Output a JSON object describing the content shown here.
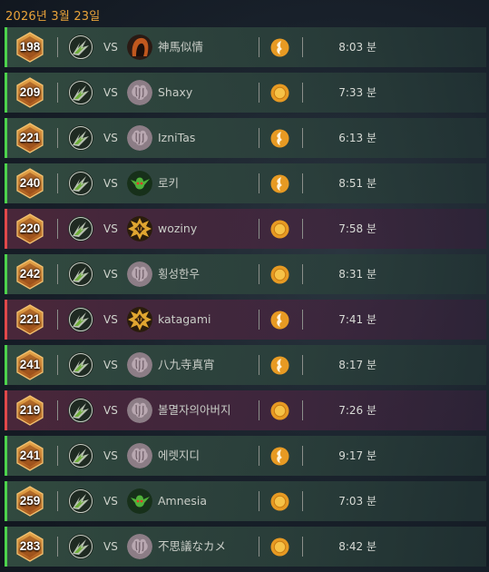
{
  "date_label": "2026년 3월 23일",
  "vs_label": "VS",
  "colors": {
    "win": "#4cd24c",
    "loss": "#e0484a",
    "accent": "#e9a33a"
  },
  "matches": [
    {
      "result": "win",
      "rating": "198",
      "opponent_icon": "hooded-icon",
      "opponent": "神馬似情",
      "medal": "swirl-medal-icon",
      "duration": "8:03 분"
    },
    {
      "result": "win",
      "rating": "209",
      "opponent_icon": "brain-icon",
      "opponent": "Shaxy",
      "medal": "coin-medal-icon",
      "duration": "7:33 분"
    },
    {
      "result": "win",
      "rating": "221",
      "opponent_icon": "brain-icon",
      "opponent": "IzniTas",
      "medal": "swirl-medal-icon",
      "duration": "6:13 분"
    },
    {
      "result": "win",
      "rating": "240",
      "opponent_icon": "goblin-icon",
      "opponent": "로키",
      "medal": "swirl-medal-icon",
      "duration": "8:51 분"
    },
    {
      "result": "loss",
      "rating": "220",
      "opponent_icon": "spiky-icon",
      "opponent": "woziny",
      "medal": "coin-medal-icon",
      "duration": "7:58 분"
    },
    {
      "result": "win",
      "rating": "242",
      "opponent_icon": "brain-icon",
      "opponent": "횡성한우",
      "medal": "coin-medal-icon",
      "duration": "8:31 분"
    },
    {
      "result": "loss",
      "rating": "221",
      "opponent_icon": "spiky-icon",
      "opponent": "katagami",
      "medal": "swirl-medal-icon",
      "duration": "7:41 분"
    },
    {
      "result": "win",
      "rating": "241",
      "opponent_icon": "brain-icon",
      "opponent": "八九寺真宵",
      "medal": "swirl-medal-icon",
      "duration": "8:17 분"
    },
    {
      "result": "loss",
      "rating": "219",
      "opponent_icon": "brain-icon",
      "opponent": "볼멸자의아버지",
      "medal": "coin-medal-icon",
      "duration": "7:26 분"
    },
    {
      "result": "win",
      "rating": "241",
      "opponent_icon": "brain-icon",
      "opponent": "에렛지디",
      "medal": "swirl-medal-icon",
      "duration": "9:17 분"
    },
    {
      "result": "win",
      "rating": "259",
      "opponent_icon": "goblin-icon",
      "opponent": "Amnesia",
      "medal": "coin-medal-icon",
      "duration": "7:03 분"
    },
    {
      "result": "win",
      "rating": "283",
      "opponent_icon": "brain-icon",
      "opponent": "不思議なカメ",
      "medal": "coin-medal-icon",
      "duration": "8:42 분"
    }
  ]
}
